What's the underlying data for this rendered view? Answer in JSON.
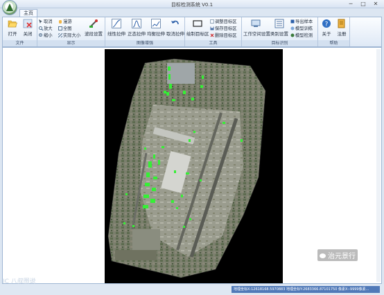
{
  "window": {
    "title": "目标检测系统 V0.1",
    "min": "─",
    "max": "□",
    "close": "✕"
  },
  "ribbon": {
    "tab_home": "主页",
    "groups": {
      "file": {
        "caption": "文件",
        "open": "打开",
        "close": "关闭"
      },
      "display": {
        "caption": "显示",
        "cancel": "取消",
        "pan": "漫游",
        "zoom_in": "放大",
        "full": "全图",
        "zoom_out": "缩小",
        "actual_size": "实际大小",
        "band_settings": "波段设置"
      },
      "enhance": {
        "caption": "图像增强",
        "linear": "线性拉伸",
        "normal": "正态拉伸",
        "equalize": "均衡拉伸",
        "cancel_stretch": "取消拉伸"
      },
      "tools": {
        "caption": "工具",
        "draw_target": "绘制目标区",
        "adjust_target": "调整目标区",
        "save_target": "保存目标区",
        "delete_target": "删除目标区"
      },
      "recognize": {
        "caption": "目标识别",
        "workspace": "工作空间设置",
        "category": "类别设置",
        "export": "导出样本",
        "train": "模型训练",
        "detect": "模型检测"
      },
      "help": {
        "caption": "帮助",
        "about": "关于",
        "register": "注册"
      }
    }
  },
  "status": {
    "coords": "地理坐标X:12618168.5970883  地理坐标Y:2683366.87101750  像素X:-9999像素..."
  },
  "watermarks": {
    "left": "IC 八叔图说",
    "right": "治元景行"
  },
  "colors": {
    "detection_box": "#35f035",
    "accent": "#5079b8"
  }
}
